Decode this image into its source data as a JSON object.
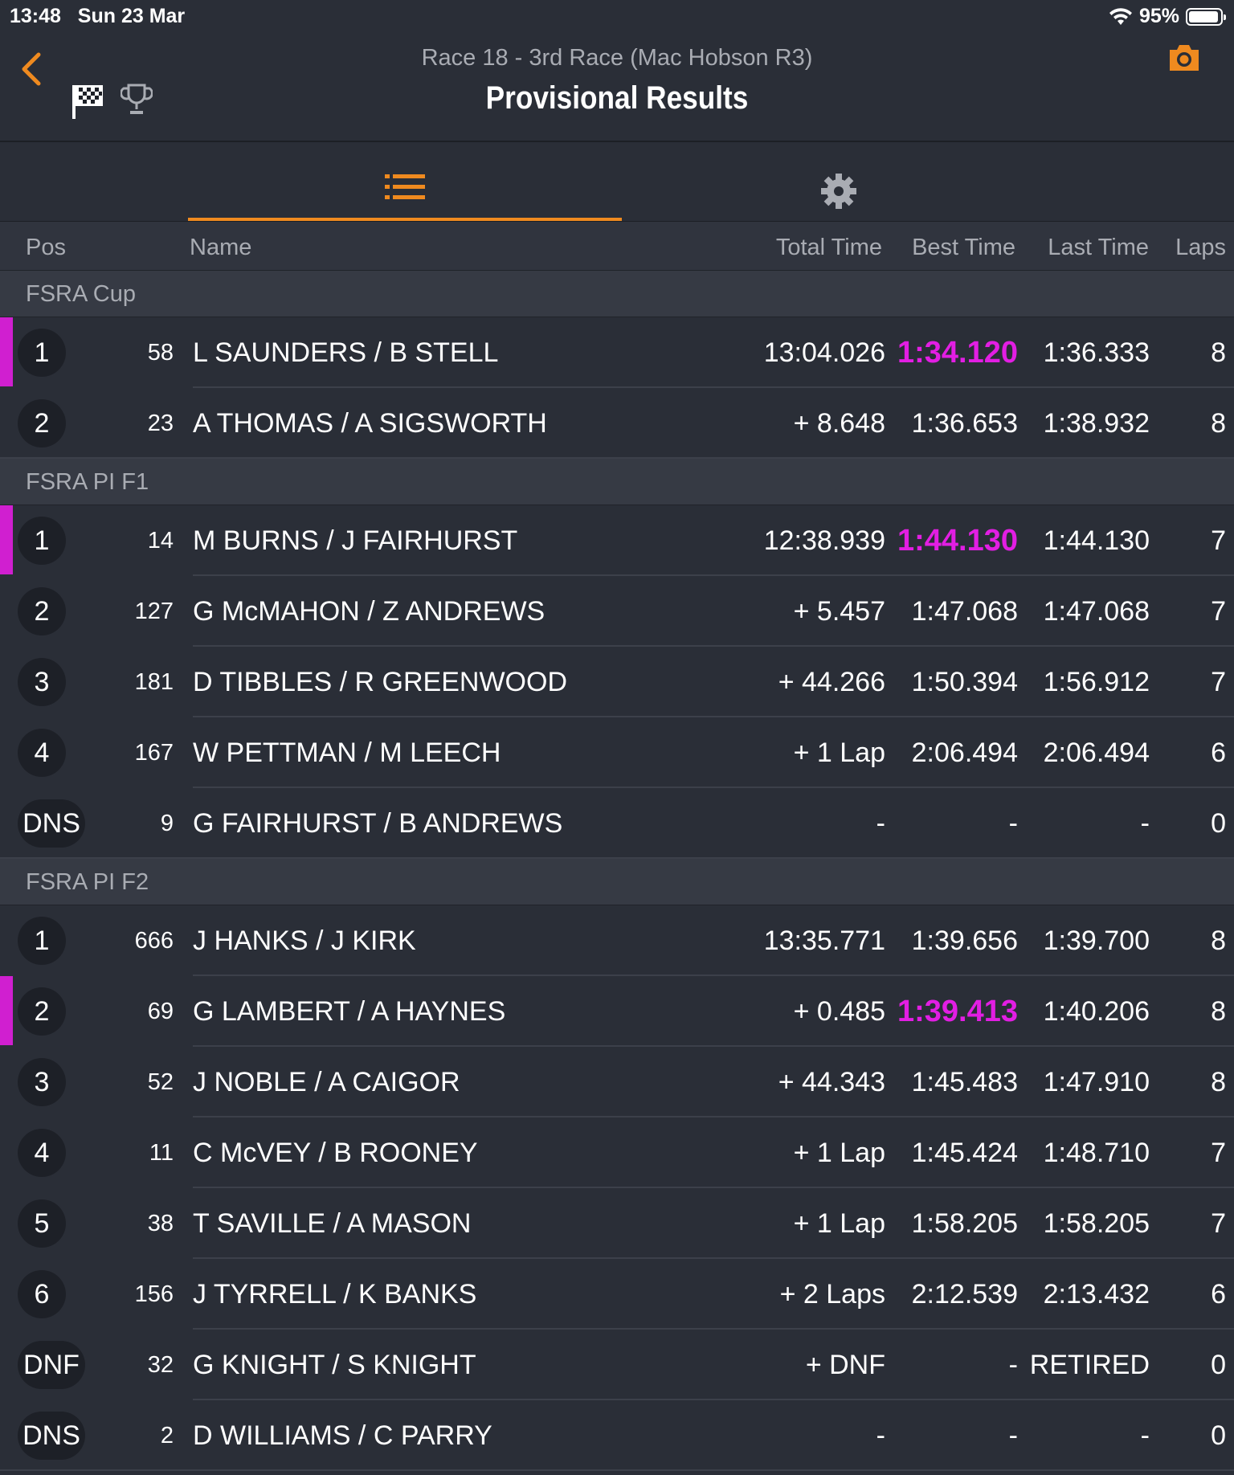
{
  "status_bar": {
    "time": "13:48   Sun 23 Mar",
    "battery": "95%",
    "battery_level": 0.95
  },
  "nav": {
    "subtitle": "Race 18 - 3rd Race (Mac Hobson R3)",
    "title": "Provisional Results"
  },
  "columns": {
    "pos": "Pos",
    "name": "Name",
    "total": "Total Time",
    "best": "Best Time",
    "last": "Last Time",
    "laps": "Laps"
  },
  "colors": {
    "accent": "#ef8a1f",
    "fastest": "#e21ee3",
    "background": "#2a2e37"
  },
  "groups": [
    {
      "title": "FSRA Cup",
      "rows": [
        {
          "pos": "1",
          "num": "58",
          "name": "L SAUNDERS / B STELL",
          "total": "13:04.026",
          "best": "1:34.120",
          "last": "1:36.333",
          "laps": "8",
          "fastest": true
        },
        {
          "pos": "2",
          "num": "23",
          "name": "A THOMAS / A SIGSWORTH",
          "total": "+ 8.648",
          "best": "1:36.653",
          "last": "1:38.932",
          "laps": "8",
          "fastest": false
        }
      ]
    },
    {
      "title": "FSRA PI F1",
      "rows": [
        {
          "pos": "1",
          "num": "14",
          "name": "M BURNS / J FAIRHURST",
          "total": "12:38.939",
          "best": "1:44.130",
          "last": "1:44.130",
          "laps": "7",
          "fastest": true
        },
        {
          "pos": "2",
          "num": "127",
          "name": "G McMAHON / Z ANDREWS",
          "total": "+ 5.457",
          "best": "1:47.068",
          "last": "1:47.068",
          "laps": "7",
          "fastest": false
        },
        {
          "pos": "3",
          "num": "181",
          "name": "D TIBBLES / R GREENWOOD",
          "total": "+ 44.266",
          "best": "1:50.394",
          "last": "1:56.912",
          "laps": "7",
          "fastest": false
        },
        {
          "pos": "4",
          "num": "167",
          "name": "W PETTMAN / M LEECH",
          "total": "+ 1 Lap",
          "best": "2:06.494",
          "last": "2:06.494",
          "laps": "6",
          "fastest": false
        },
        {
          "pos": "DNS",
          "num": "9",
          "name": "G FAIRHURST / B ANDREWS",
          "total": "-",
          "best": "-",
          "last": "-",
          "laps": "0",
          "fastest": false
        }
      ]
    },
    {
      "title": "FSRA PI F2",
      "rows": [
        {
          "pos": "1",
          "num": "666",
          "name": "J HANKS / J KIRK",
          "total": "13:35.771",
          "best": "1:39.656",
          "last": "1:39.700",
          "laps": "8",
          "fastest": false
        },
        {
          "pos": "2",
          "num": "69",
          "name": "G LAMBERT / A HAYNES",
          "total": "+ 0.485",
          "best": "1:39.413",
          "last": "1:40.206",
          "laps": "8",
          "fastest": true
        },
        {
          "pos": "3",
          "num": "52",
          "name": "J NOBLE / A CAIGOR",
          "total": "+ 44.343",
          "best": "1:45.483",
          "last": "1:47.910",
          "laps": "8",
          "fastest": false
        },
        {
          "pos": "4",
          "num": "11",
          "name": "C McVEY / B ROONEY",
          "total": "+ 1 Lap",
          "best": "1:45.424",
          "last": "1:48.710",
          "laps": "7",
          "fastest": false
        },
        {
          "pos": "5",
          "num": "38",
          "name": "T SAVILLE / A MASON",
          "total": "+ 1 Lap",
          "best": "1:58.205",
          "last": "1:58.205",
          "laps": "7",
          "fastest": false
        },
        {
          "pos": "6",
          "num": "156",
          "name": "J TYRRELL / K BANKS",
          "total": "+ 2 Laps",
          "best": "2:12.539",
          "last": "2:13.432",
          "laps": "6",
          "fastest": false
        },
        {
          "pos": "DNF",
          "num": "32",
          "name": "G KNIGHT / S KNIGHT",
          "total": "+ DNF",
          "best": "-",
          "last": "RETIRED",
          "laps": "0",
          "fastest": false
        },
        {
          "pos": "DNS",
          "num": "2",
          "name": "D WILLIAMS / C PARRY",
          "total": "-",
          "best": "-",
          "last": "-",
          "laps": "0",
          "fastest": false
        }
      ]
    }
  ]
}
